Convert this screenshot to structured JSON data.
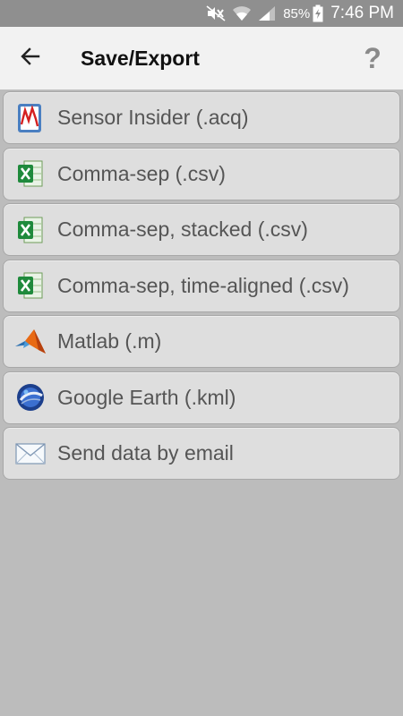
{
  "status_bar": {
    "icons": [
      "mute-icon",
      "wifi-icon",
      "signal-icon",
      "battery-icon"
    ],
    "battery_percent": "85%",
    "time": "7:46 PM"
  },
  "action_bar": {
    "back_icon": "arrow-left-icon",
    "title": "Save/Export",
    "help_label": "?"
  },
  "items": [
    {
      "label": "Sensor Insider (.acq)",
      "icon": "sensor-insider-icon"
    },
    {
      "label": "Comma-sep (.csv)",
      "icon": "spreadsheet-icon"
    },
    {
      "label": "Comma-sep, stacked (.csv)",
      "icon": "spreadsheet-icon"
    },
    {
      "label": "Comma-sep, time-aligned (.csv)",
      "icon": "spreadsheet-icon"
    },
    {
      "label": "Matlab (.m)",
      "icon": "matlab-icon"
    },
    {
      "label": "Google Earth (.kml)",
      "icon": "google-earth-icon"
    },
    {
      "label": "Send data by email",
      "icon": "envelope-icon"
    }
  ],
  "colors": {
    "status_bar": "#8f8f8f",
    "action_bar": "#f2f2f2",
    "background": "#bcbcbc",
    "item_background": "#dedede",
    "item_text": "#555555"
  }
}
